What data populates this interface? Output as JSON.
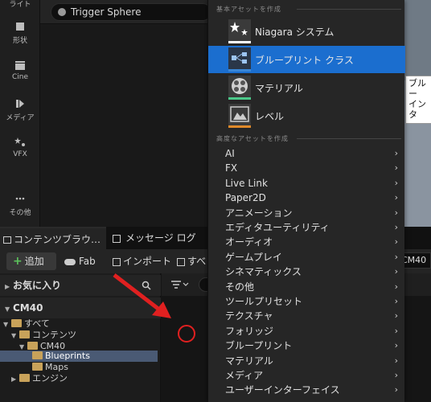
{
  "left_toolbar": {
    "items": [
      {
        "label": "ライト",
        "icon": "light-icon"
      },
      {
        "label": "形状",
        "icon": "shapes-icon"
      },
      {
        "label": "Cine",
        "icon": "cine-icon"
      },
      {
        "label": "メディア",
        "icon": "media-icon"
      },
      {
        "label": "VFX",
        "icon": "vfx-icon"
      },
      {
        "label": "その他",
        "icon": "more-icon"
      }
    ]
  },
  "viewport": {
    "selected_actor": "Trigger Sphere"
  },
  "tooltip": {
    "line1": "ブルー",
    "line2": "インタ"
  },
  "content_browser": {
    "tab_label": "コンテンツブラウ…",
    "tab_close": "×",
    "message_log_tab": "メッセージ ログ",
    "add_button": "追加",
    "add_plus": "+",
    "fab_button": "Fab",
    "import_button": "インポート",
    "save_button": "すべ",
    "path_value": "CM40",
    "favorites_label": "お気に入り",
    "project_label": "CM40",
    "tree": [
      {
        "label": "すべて",
        "level": 0,
        "expanded": true
      },
      {
        "label": "コンテンツ",
        "level": 1,
        "expanded": true
      },
      {
        "label": "CM40",
        "level": 2,
        "expanded": true
      },
      {
        "label": "Blueprints",
        "level": 3,
        "selected": true
      },
      {
        "label": "Maps",
        "level": 3
      },
      {
        "label": "エンジン",
        "level": 1,
        "expanded": false
      }
    ]
  },
  "popup_menu": {
    "basic_header": "基本アセットを作成",
    "basic_items": [
      {
        "label": "Niagara システム",
        "icon": "niagara-icon",
        "accent": "#ffffff"
      },
      {
        "label": "ブループリント クラス",
        "icon": "blueprint-class-icon",
        "accent": "#3a86d6",
        "selected": true
      },
      {
        "label": "マテリアル",
        "icon": "material-icon",
        "accent": "#4bc98a"
      },
      {
        "label": "レベル",
        "icon": "level-icon",
        "accent": "#e08a2a"
      }
    ],
    "advanced_header": "高度なアセットを作成",
    "advanced_items": [
      "AI",
      "FX",
      "Live Link",
      "Paper2D",
      "アニメーション",
      "エディタユーティリティ",
      "オーディオ",
      "ゲームプレイ",
      "シネマティックス",
      "その他",
      "ツールプリセット",
      "テクスチャ",
      "フォリッジ",
      "ブループリント",
      "マテリアル",
      "メディア",
      "ユーザーインターフェイス"
    ],
    "submenu_chevron": "›"
  },
  "colors": {
    "selection_blue": "#1b6ecf",
    "annotation_red": "#e02020"
  }
}
